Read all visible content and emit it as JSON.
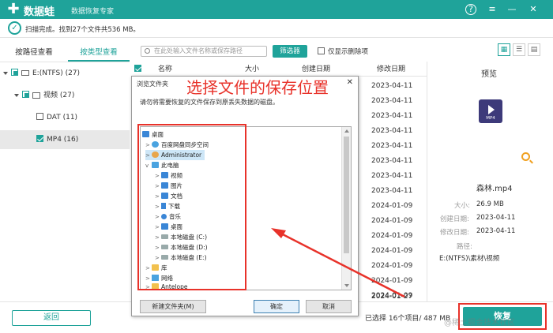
{
  "titlebar": {
    "app_name": "数据蛙",
    "app_subtitle": "数据恢复专家",
    "help_icon": "?",
    "menu_icon": "≡",
    "minimize_icon": "—",
    "close_icon": "✕"
  },
  "status": {
    "scan_done_text": "扫描完成。找到27个文件共536 MB。"
  },
  "tabs": {
    "by_path": "按路径查看",
    "by_type": "按类型查看"
  },
  "tree": {
    "drive": "E:(NTFS) (27)",
    "video": "视频 (27)",
    "dat": "DAT (11)",
    "mp4": "MP4 (16)"
  },
  "toolbar": {
    "search_placeholder": "在此处输入文件名称或保存路径",
    "filter_label": "筛选器",
    "deleted_only_label": "仅显示删除项"
  },
  "columns": {
    "name": "名称",
    "size": "大小",
    "created": "创建日期",
    "modified": "修改日期"
  },
  "dates": [
    "2023-04-11",
    "2023-04-11",
    "2023-04-11",
    "2023-04-11",
    "2023-04-11",
    "2023-04-11",
    "2023-04-11",
    "2023-04-11",
    "2024-01-09",
    "2024-01-09",
    "2024-01-09",
    "2024-01-09",
    "2024-01-09",
    "2024-01-09",
    "2024-01-09",
    "2024-01-27"
  ],
  "preview": {
    "title": "预览",
    "filename": "森林.mp4",
    "size_label": "大小:",
    "size_value": "26.9 MB",
    "created_label": "创建日期:",
    "created_value": "2023-04-11",
    "modified_label": "修改日期:",
    "modified_value": "2023-04-11",
    "path_label": "路径:",
    "path_value": "E:(NTFS)\\素材\\视频"
  },
  "bottom": {
    "back_label": "返回",
    "selected_text": "已选择 16个项目/ 487 MB",
    "recover_label": "恢复",
    "watermark": "@稀土掘金技术社区"
  },
  "dialog": {
    "title": "浏览文件夹",
    "close": "✕",
    "message": "请勿将需要恢复的文件保存到原丢失数据的磁盘。",
    "items": {
      "desktop": "桌面",
      "baidu": "百度网盘同步空间",
      "admin": "Administrator",
      "this_pc": "此电脑",
      "videos": "视频",
      "pictures": "图片",
      "documents": "文档",
      "downloads": "下载",
      "music": "音乐",
      "desktop2": "桌面",
      "disk_c": "本地磁盘 (C:)",
      "disk_d": "本地磁盘 (D:)",
      "disk_e": "本地磁盘 (E:)",
      "library": "库",
      "network": "网络",
      "antelope": "Antelope"
    },
    "new_folder_label": "新建文件夹(M)",
    "ok_label": "确定",
    "cancel_label": "取消"
  },
  "annotation": {
    "text": "选择文件的保存位置"
  },
  "colors": {
    "brand": "#1fa39a",
    "annotation_red": "#e8322a"
  }
}
